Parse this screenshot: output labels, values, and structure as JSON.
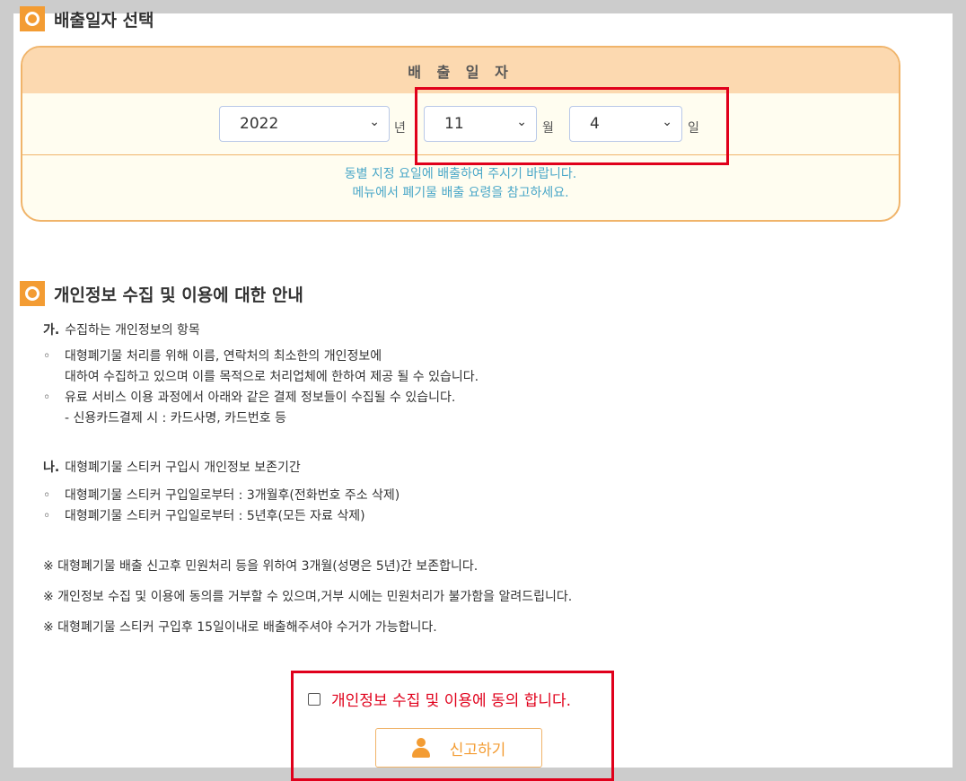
{
  "date_section": {
    "title": "배출일자 선택",
    "header": "배 출 일 자",
    "year": {
      "value": "2022",
      "unit": "년"
    },
    "month": {
      "value": "11",
      "unit": "월"
    },
    "day": {
      "value": "4",
      "unit": "일"
    },
    "note_line1": "동별 지정 요일에 배출하여 주시기 바랍니다.",
    "note_line2": "메뉴에서 폐기물 배출 요령을 참고하세요."
  },
  "privacy_section": {
    "title": "개인정보 수집 및 이용에 대한 안내",
    "part_a": {
      "label": "가.",
      "heading": "수집하는 개인정보의 항목",
      "item1_line1": "대형폐기물 처리를 위해 이름, 연락처의 최소한의 개인정보에",
      "item1_line2": "대하여 수집하고 있으며 이를 목적으로 처리업체에 한하여 제공 될 수 있습니다.",
      "item2_line1": "유료 서비스 이용 과정에서 아래와 같은 결제 정보들이 수집될 수 있습니다.",
      "item2_line2": "- 신용카드결제 시 : 카드사명, 카드번호 등"
    },
    "part_b": {
      "label": "나.",
      "heading": "대형폐기물 스티커 구입시 개인정보 보존기간",
      "item1": "대형폐기물 스티커 구입일로부터 : 3개월후(전화번호 주소 삭제)",
      "item2": "대형폐기물 스티커 구입일로부터 : 5년후(모든 자료 삭제)"
    },
    "notes": [
      "※ 대형폐기물 배출 신고후 민원처리 등을 위하여 3개월(성명은 5년)간 보존합니다.",
      "※ 개인정보 수집 및 이용에 동의를 거부할 수 있으며,거부 시에는 민원처리가 불가함을 알려드립니다.",
      "※ 대형폐기물 스티커 구입후 15일이내로 배출해주셔야 수거가 가능합니다."
    ]
  },
  "agree_label": "개인정보 수집 및 이용에 동의 합니다.",
  "agree_checked": false,
  "submit_label": "신고하기",
  "colors": {
    "accent": "#f39c33",
    "highlight": "#e0001b",
    "note": "#4aa7c8"
  }
}
